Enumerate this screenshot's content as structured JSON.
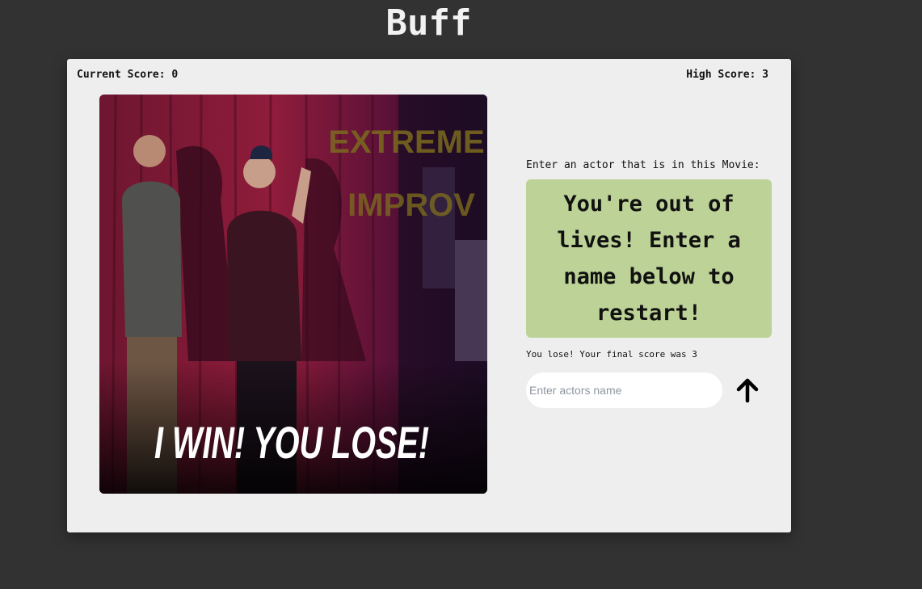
{
  "app": {
    "title": "Buff"
  },
  "scores": {
    "current": "Current Score: 0",
    "high": "High Score: 3"
  },
  "poster": {
    "top_text_1": "EXTREME",
    "top_text_2": "IMPROV",
    "caption": "I WIN! YOU LOSE!"
  },
  "game": {
    "prompt": "Enter an actor that is in this Movie:",
    "message": "You're out of lives! Enter a name below to restart!",
    "result": "You lose! Your final score was 3",
    "input_placeholder": "Enter actors name",
    "input_value": ""
  },
  "icons": {
    "submit": "arrow-up-icon"
  },
  "colors": {
    "background": "#323232",
    "card": "#eeeeee",
    "message_box": "#bcd296"
  }
}
